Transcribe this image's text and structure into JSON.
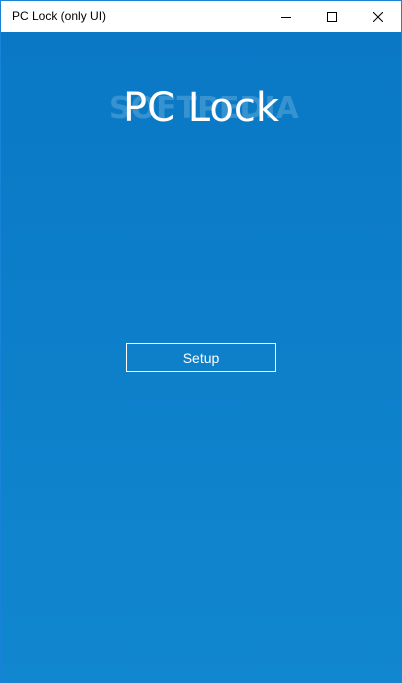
{
  "window": {
    "title": "PC Lock (only UI)",
    "controls": {
      "minimize_icon": "minimize-icon",
      "maximize_icon": "maximize-icon",
      "close_icon": "close-icon"
    },
    "border_color": "#1883d7"
  },
  "main": {
    "app_title": "PC Lock",
    "setup_label": "Setup",
    "watermark": "SOFTPEDIA",
    "background_top": "#0a78c5",
    "background_bottom": "#1187cf",
    "foreground": "#ffffff"
  }
}
